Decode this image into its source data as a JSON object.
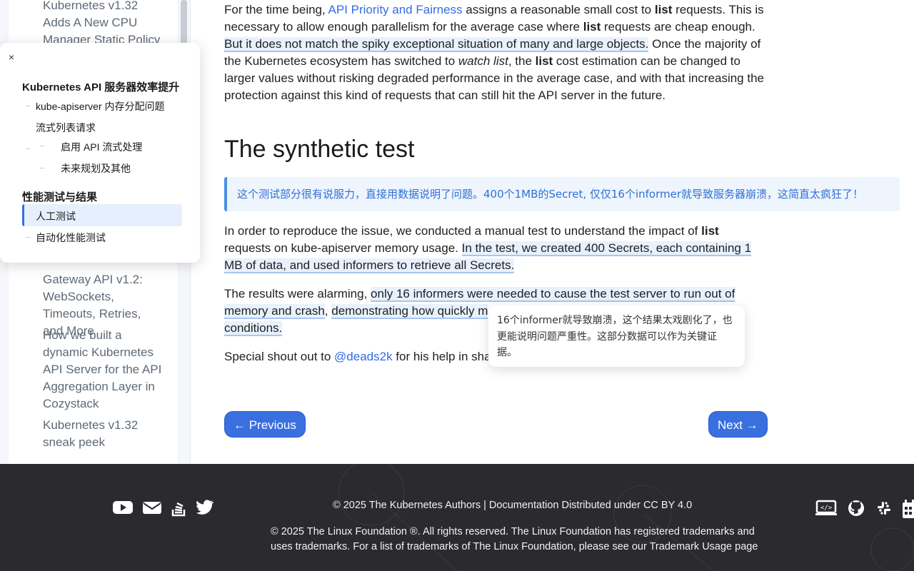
{
  "left_rail": {
    "items": [
      "Kubernetes v1.32 Adds A New CPU Manager Static Policy",
      "Gateway API v1.2: WebSockets, Timeouts, Retries, and More",
      "How we built a dynamic Kubernetes API Server for the API Aggregation Layer in Cozystack",
      "Kubernetes v1.32 sneak peek"
    ]
  },
  "toc": {
    "close_label": "×",
    "heading": "Kubernetes API 服务器效率提升",
    "items": [
      "kube-apiserver 内存分配问题",
      "流式列表请求",
      "启用 API 流式处理",
      "未来规划及其他",
      "性能测试与结果",
      "人工测试",
      "自动化性能测试"
    ]
  },
  "article": {
    "p1": {
      "a": "For the time being, ",
      "link": "API Priority and Fairness",
      "b": " assigns a reasonable small cost to ",
      "bold1": "list",
      "c": " requests. This is necessary to allow enough parallelism for the average case where ",
      "bold2": "list",
      "d": " requests are cheap enough. ",
      "hl": "But it does not match the spiky exceptional situation of many and large objects.",
      "e": " Once the majority of the Kubernetes ecosystem has switched to ",
      "em": "watch list",
      "f": ", the ",
      "bold3": "list",
      "g": " cost estimation can be changed to larger values without risking degraded performance in the average case, and with that increasing the protection against this kind of requests that can still hit the API server in the future."
    },
    "heading": "The synthetic test",
    "callout": "这个测试部分很有说服力，直接用数据说明了问题。400个1MB的Secret, 仅仅16个informer就导致服务器崩溃，这简直太疯狂了！",
    "p2": {
      "a": "In order to reproduce the issue, we conducted a manual test to understand the impact of ",
      "bold": "list",
      "b": " requests on kube-apiserver memory usage. ",
      "hl": "In the test, we created 400 Secrets, each containing 1 MB of data, and used informers to retrieve all Secrets."
    },
    "p3": {
      "a": "The results were alarming, ",
      "hl1": "only 16 informers were needed to cause the test server to run out of memory and crash",
      "b": ", ",
      "hl2": "demonstrating how quickly m",
      "hl3": "conditions."
    },
    "p4": {
      "a": "Special shout out to ",
      "link": "@deads2k",
      "b": " for his help in shap"
    },
    "tooltip": "16个informer就导致崩溃，这个结果太戏剧化了，也更能说明问题严重性。这部分数据可以作为关键证据。",
    "prev_label": "← Previous",
    "next_label": "Next →"
  },
  "footer": {
    "line1": "© 2025 The Kubernetes Authors | Documentation Distributed under CC BY 4.0",
    "line2": "© 2025 The Linux Foundation ®. All rights reserved. The Linux Foundation has registered trademarks and",
    "line3a": "uses trademarks. For a list of trademarks of The Linux Foundation, please see our ",
    "line3b": "Trademark Usage page",
    "left_icons": [
      "youtube-icon",
      "mail-icon",
      "stackoverflow-icon",
      "twitter-icon"
    ],
    "right_icons": [
      "contribute-icon",
      "github-icon",
      "slack-icon",
      "calendar-icon"
    ]
  }
}
